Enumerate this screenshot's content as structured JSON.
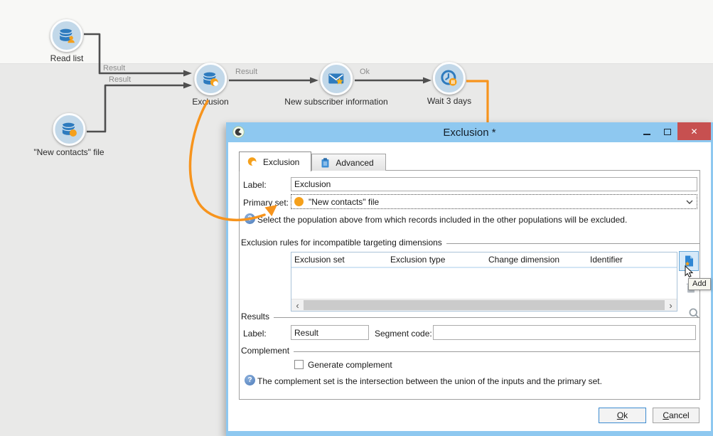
{
  "canvas": {
    "nodes": [
      {
        "label": "Read list"
      },
      {
        "label": "\"New contacts\" file"
      },
      {
        "label": "Exclusion"
      },
      {
        "label": "New subscriber information"
      },
      {
        "label": "Wait 3 days"
      }
    ],
    "edge_labels": {
      "read_to_exclusion": "Result",
      "contacts_to_exclusion": "Result",
      "exclusion_to_subscriber": "Result",
      "subscriber_to_wait": "Ok"
    }
  },
  "dialog": {
    "title": "Exclusion *",
    "window": {
      "close_glyph": "✕"
    },
    "tabs": [
      {
        "label": "Exclusion"
      },
      {
        "label": "Advanced"
      }
    ],
    "form": {
      "label_caption": "Label:",
      "label_value": "Exclusion",
      "primary_caption": "Primary set:",
      "primary_value": "\"New contacts\" file",
      "primary_help": "Select the population above from which records included in the other populations will be excluded."
    },
    "rules": {
      "group_title": "Exclusion rules for incompatible targeting dimensions",
      "columns": [
        "Exclusion set",
        "Exclusion type",
        "Change dimension",
        "Identifier"
      ],
      "rows": [],
      "add_tooltip": "Add",
      "scroll_left_glyph": "‹",
      "scroll_right_glyph": "›"
    },
    "results": {
      "group_title": "Results",
      "label_caption": "Label:",
      "label_value": "Result",
      "segment_caption": "Segment code:",
      "segment_value": ""
    },
    "complement": {
      "group_title": "Complement",
      "checkbox_label": "Generate complement",
      "checked": false,
      "help": "The complement set is the intersection between the union of the inputs and the primary set."
    },
    "footer": {
      "ok_label": "Ok",
      "cancel_label": "Cancel"
    },
    "help_glyph": "?"
  },
  "colors": {
    "accent_orange": "#f7941d",
    "node_blue": "#2e7bbe",
    "titlebar_blue": "#8ec8f0",
    "close_red": "#c75050",
    "canvas_top_band": "#f8f8f6",
    "canvas_main": "#e9e9e8"
  }
}
